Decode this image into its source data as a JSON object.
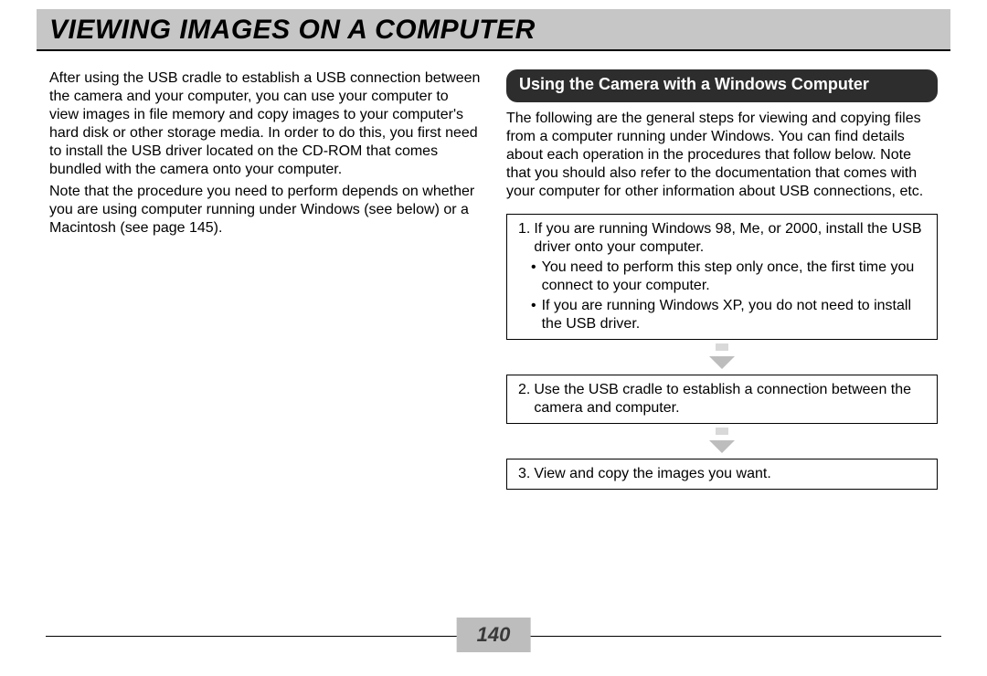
{
  "header": {
    "title": "VIEWING IMAGES ON A COMPUTER"
  },
  "left": {
    "para1": "After using the USB cradle to establish a USB connection between the camera and your computer, you can use your computer to view images in file memory and copy images to your computer's hard disk or other storage media. In order to do this, you first need to install the USB driver located on the CD-ROM that comes bundled with the camera onto your computer.",
    "para2": "Note that the procedure you need to perform depends on whether you are using computer running under Windows (see below) or a Macintosh (see page 145)."
  },
  "right": {
    "subhead": "Using the Camera with a Windows Computer",
    "intro": "The following are the general steps for viewing and copying files from a computer running under Windows. You can find details about each operation in the procedures that follow below. Note that you should also refer to the documentation that comes with your computer for other information about USB connections, etc.",
    "steps": [
      {
        "num": "1.",
        "text": "If you are running Windows 98, Me, or 2000, install the USB driver onto your computer.",
        "bullets": [
          "You need to perform this step only once, the first time you connect to your computer.",
          "If you are running Windows XP, you do not need to install the USB driver."
        ]
      },
      {
        "num": "2.",
        "text": "Use the USB cradle to establish a connection between the camera and computer.",
        "bullets": []
      },
      {
        "num": "3.",
        "text": "View and copy the images you want.",
        "bullets": []
      }
    ]
  },
  "page_number": "140"
}
